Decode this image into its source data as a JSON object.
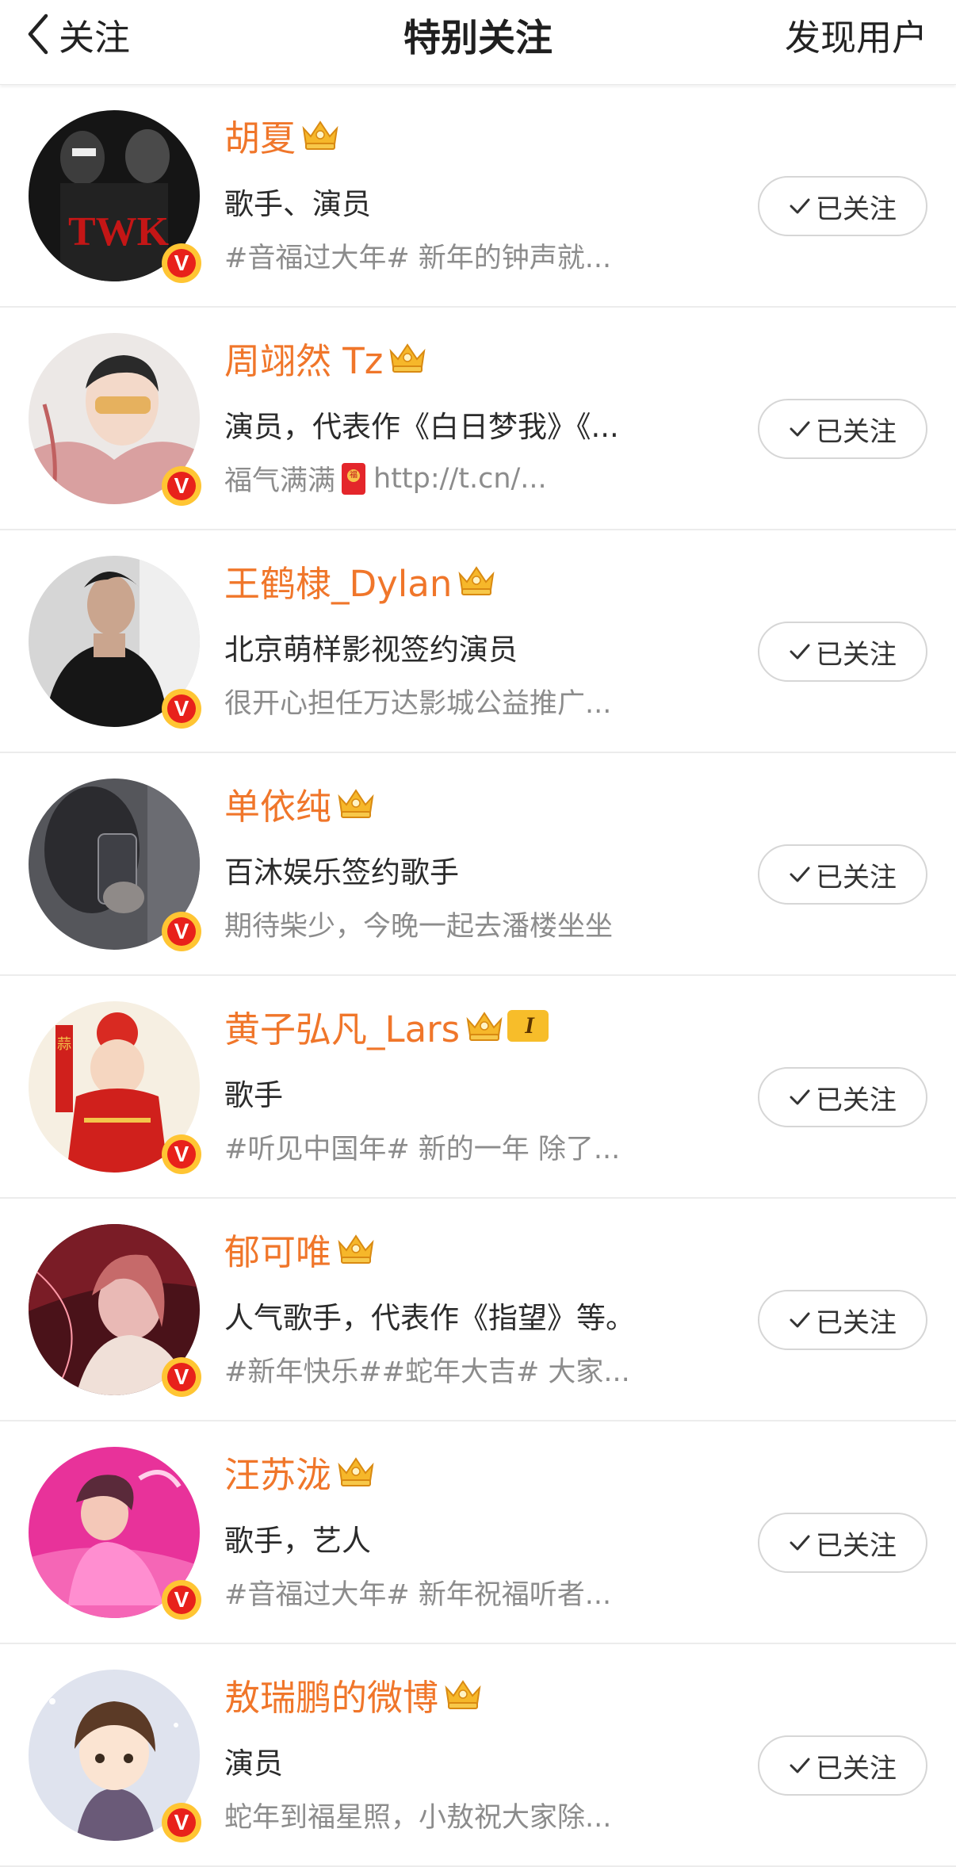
{
  "nav": {
    "back_label": "关注",
    "title": "特别关注",
    "discover_label": "发现用户"
  },
  "colors": {
    "name": "#f0762a",
    "verified_badge": "#e8211b",
    "badge_ring": "#ffc533"
  },
  "follow_label": "已关注",
  "users": [
    {
      "name": "胡夏",
      "bio": "歌手、演员",
      "status": "#音福过大年# 新年的钟声就...",
      "badge": "crown-icon"
    },
    {
      "name": "周翊然 Tz",
      "bio": "演员，代表作《白日梦我》《...",
      "status_prefix": "福气满满",
      "status": "http://t.cn/...",
      "badge": "crown-icon"
    },
    {
      "name": "王鹤棣_Dylan",
      "bio": "北京萌样影视签约演员",
      "status": "很开心担任万达影城公益推广...",
      "badge": "crown-icon"
    },
    {
      "name": "单依纯",
      "bio": "百沐娱乐签约歌手",
      "status": "期待柴少，今晚一起去潘楼坐坐",
      "badge": "crown-icon"
    },
    {
      "name": "黄子弘凡_Lars",
      "bio": "歌手",
      "status": "#听见中国年# 新的一年 除了...",
      "badge": "crown-icon",
      "level": "I"
    },
    {
      "name": "郁可唯",
      "bio": "人气歌手，代表作《指望》等。",
      "status": "#新年快乐##蛇年大吉# 大家...",
      "badge": "crown-icon"
    },
    {
      "name": "汪苏泷",
      "bio": "歌手，艺人",
      "status": "#音福过大年# 新年祝福听者...",
      "badge": "crown-icon"
    },
    {
      "name": "敖瑞鹏的微博",
      "bio": "演员",
      "status": "蛇年到福星照，小敖祝大家除...",
      "badge": "crown-icon"
    }
  ]
}
